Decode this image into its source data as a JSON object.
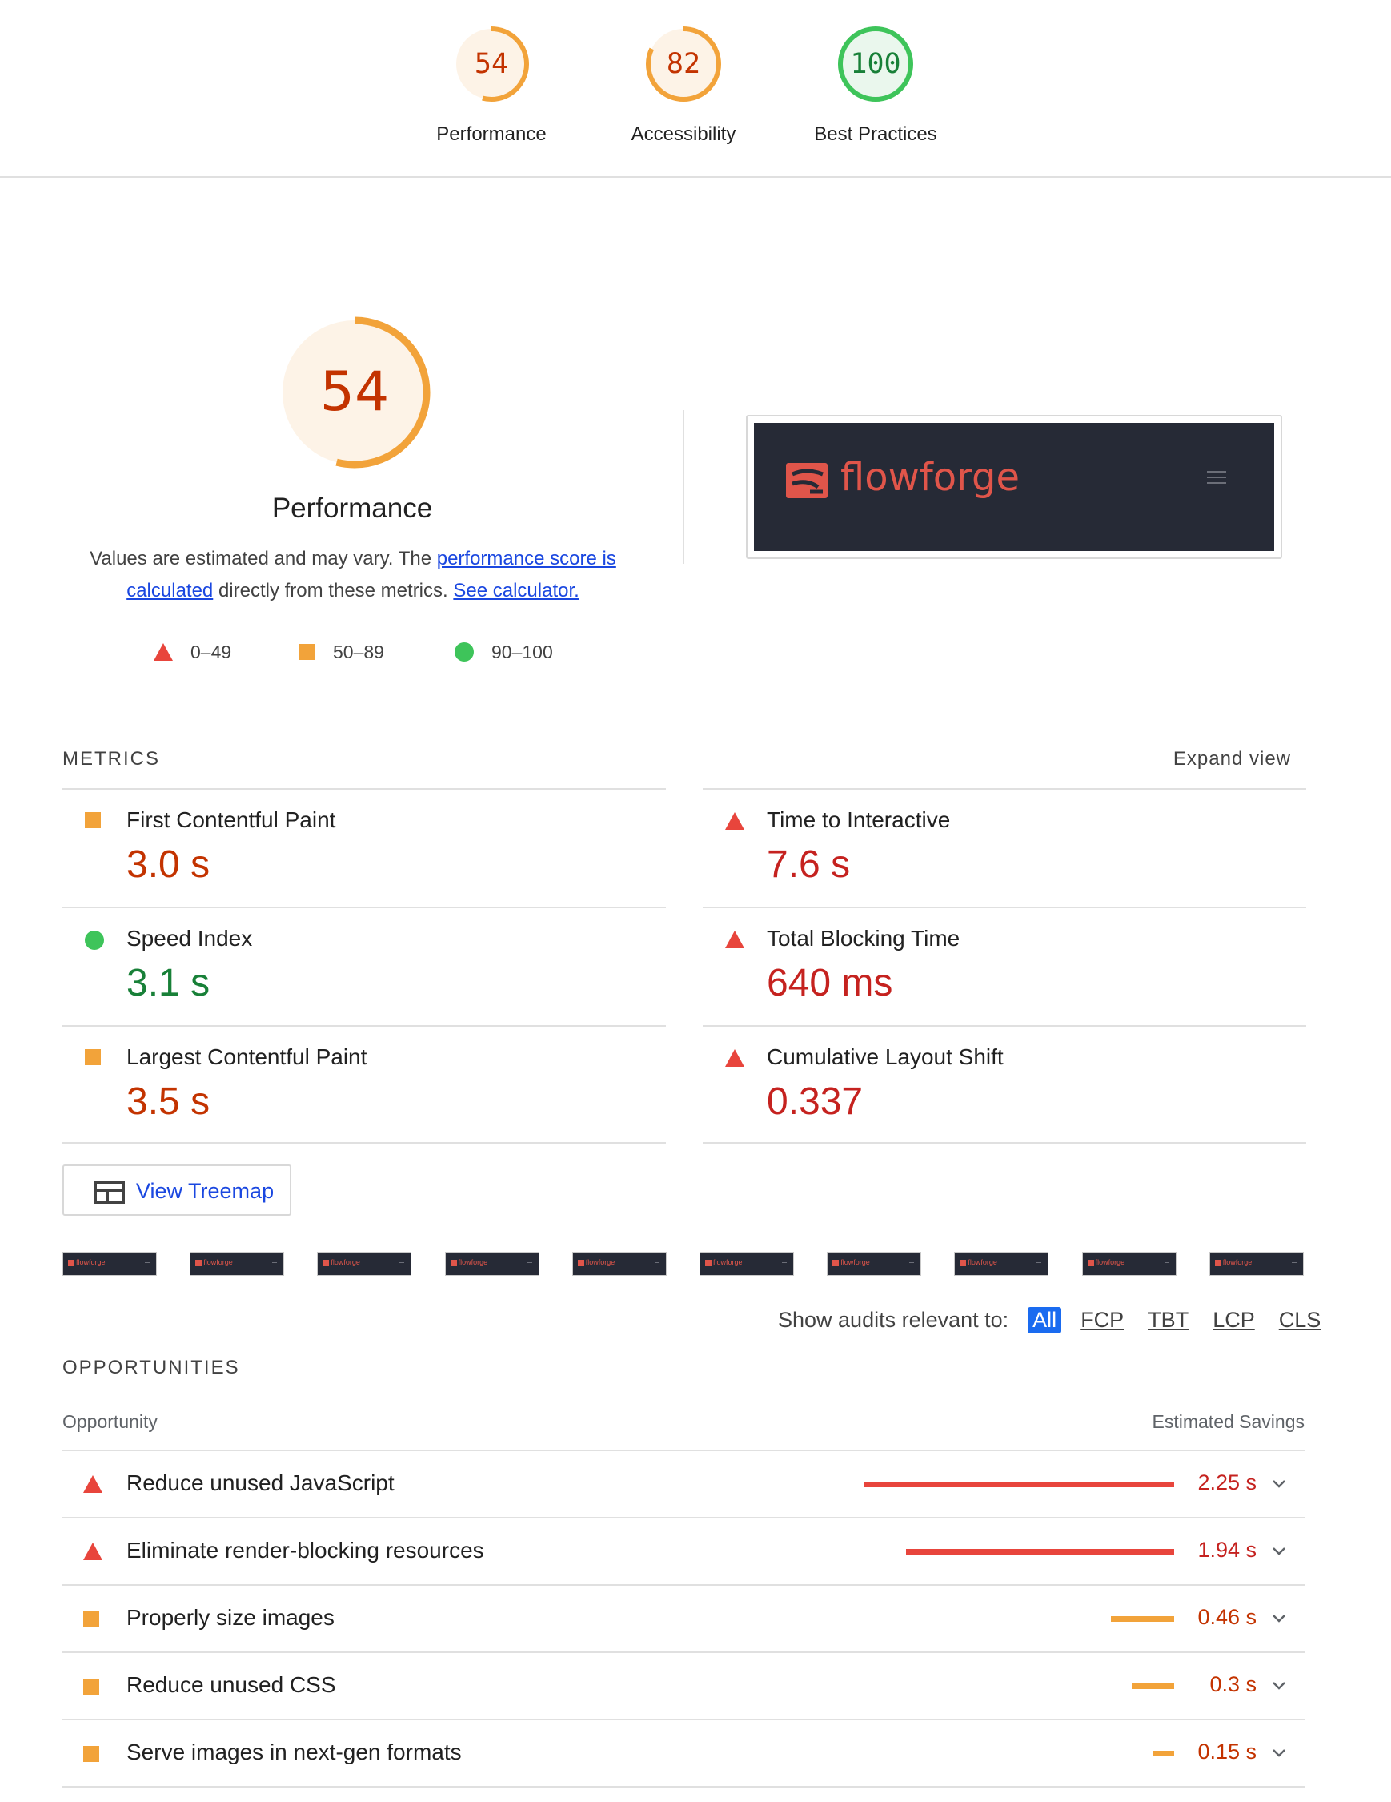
{
  "summary": [
    {
      "score": "54",
      "label": "Performance",
      "fraction": 0.54,
      "color": "#f2a33a",
      "text_color": "#c33300"
    },
    {
      "score": "82",
      "label": "Accessibility",
      "fraction": 0.82,
      "color": "#f2a33a",
      "text_color": "#c33300"
    },
    {
      "score": "100",
      "label": "Best Practices",
      "fraction": 1.0,
      "color": "#3ec45a",
      "text_color": "#188038"
    }
  ],
  "performance": {
    "score": "54",
    "fraction": 0.54,
    "title": "Performance",
    "desc_prefix": "Values are estimated and may vary. The ",
    "desc_link1": "performance score is calculated",
    "desc_middle": " directly from these metrics. ",
    "desc_link2": "See calculator.",
    "legend": [
      "0–49",
      "50–89",
      "90–100"
    ]
  },
  "screenshot": {
    "brand": "flowforge"
  },
  "metrics": {
    "heading": "METRICS",
    "expand_label": "Expand view",
    "items": [
      {
        "name": "First Contentful Paint",
        "value": "3.0 s",
        "rating": "average"
      },
      {
        "name": "Time to Interactive",
        "value": "7.6 s",
        "rating": "fail"
      },
      {
        "name": "Speed Index",
        "value": "3.1 s",
        "rating": "pass"
      },
      {
        "name": "Total Blocking Time",
        "value": "640 ms",
        "rating": "fail"
      },
      {
        "name": "Largest Contentful Paint",
        "value": "3.5 s",
        "rating": "average"
      },
      {
        "name": "Cumulative Layout Shift",
        "value": "0.337",
        "rating": "fail"
      }
    ]
  },
  "treemap": {
    "label": "View Treemap"
  },
  "filmstrip": {
    "thumb_label": "flowforge",
    "count": 10
  },
  "filter": {
    "label": "Show audits relevant to:",
    "options": [
      "All",
      "FCP",
      "TBT",
      "LCP",
      "CLS"
    ],
    "selected": "All"
  },
  "opportunities": {
    "heading": "OPPORTUNITIES",
    "col_left": "Opportunity",
    "col_right": "Estimated Savings",
    "items": [
      {
        "name": "Reduce unused JavaScript",
        "savings": "2.25 s",
        "savings_s": 2.25,
        "rating": "fail"
      },
      {
        "name": "Eliminate render-blocking resources",
        "savings": "1.94 s",
        "savings_s": 1.94,
        "rating": "fail"
      },
      {
        "name": "Properly size images",
        "savings": "0.46 s",
        "savings_s": 0.46,
        "rating": "average"
      },
      {
        "name": "Reduce unused CSS",
        "savings": "0.3 s",
        "savings_s": 0.3,
        "rating": "average"
      },
      {
        "name": "Serve images in next-gen formats",
        "savings": "0.15 s",
        "savings_s": 0.15,
        "rating": "average"
      }
    ]
  },
  "colors": {
    "fail": "#e8453c",
    "average": "#f2a33a",
    "pass": "#3ec45a",
    "link": "#1a47e0"
  }
}
